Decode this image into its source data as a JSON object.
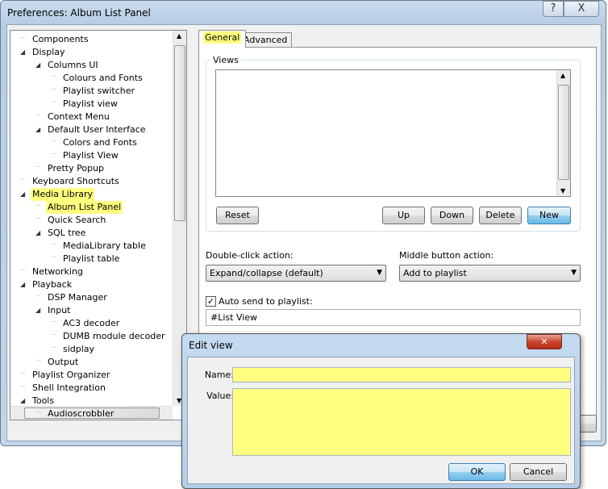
{
  "window": {
    "title": "Preferences: Album List Panel",
    "help_label": "?",
    "close_label": "X"
  },
  "tree": {
    "items": [
      {
        "label": "Components",
        "level": 0,
        "expanded": null
      },
      {
        "label": "Display",
        "level": 0,
        "expanded": true
      },
      {
        "label": "Columns UI",
        "level": 1,
        "expanded": true
      },
      {
        "label": "Colours and Fonts",
        "level": 2,
        "expanded": null
      },
      {
        "label": "Playlist switcher",
        "level": 2,
        "expanded": null
      },
      {
        "label": "Playlist view",
        "level": 2,
        "expanded": null
      },
      {
        "label": "Context Menu",
        "level": 1,
        "expanded": null
      },
      {
        "label": "Default User Interface",
        "level": 1,
        "expanded": true
      },
      {
        "label": "Colors and Fonts",
        "level": 2,
        "expanded": null
      },
      {
        "label": "Playlist View",
        "level": 2,
        "expanded": null
      },
      {
        "label": "Pretty Popup",
        "level": 1,
        "expanded": null
      },
      {
        "label": "Keyboard Shortcuts",
        "level": 0,
        "expanded": null
      },
      {
        "label": "Media Library",
        "level": 0,
        "expanded": true,
        "highlight": true
      },
      {
        "label": "Album List Panel",
        "level": 1,
        "expanded": null,
        "highlight": true,
        "selected": true
      },
      {
        "label": "Quick Search",
        "level": 1,
        "expanded": null
      },
      {
        "label": "SQL tree",
        "level": 1,
        "expanded": true
      },
      {
        "label": "MediaLibrary table",
        "level": 2,
        "expanded": null
      },
      {
        "label": "Playlist table",
        "level": 2,
        "expanded": null
      },
      {
        "label": "Networking",
        "level": 0,
        "expanded": null
      },
      {
        "label": "Playback",
        "level": 0,
        "expanded": true
      },
      {
        "label": "DSP Manager",
        "level": 1,
        "expanded": null
      },
      {
        "label": "Input",
        "level": 1,
        "expanded": true
      },
      {
        "label": "AC3 decoder",
        "level": 2,
        "expanded": null
      },
      {
        "label": "DUMB module decoder",
        "level": 2,
        "expanded": null
      },
      {
        "label": "sidplay",
        "level": 2,
        "expanded": null
      },
      {
        "label": "Output",
        "level": 1,
        "expanded": null
      },
      {
        "label": "Playlist Organizer",
        "level": 0,
        "expanded": null
      },
      {
        "label": "Shell Integration",
        "level": 0,
        "expanded": null
      },
      {
        "label": "Tools",
        "level": 0,
        "expanded": true
      },
      {
        "label": "Audioscrobbler",
        "level": 1,
        "expanded": null
      }
    ]
  },
  "tabs": [
    {
      "label": "General",
      "active": true
    },
    {
      "label": "Advanced",
      "active": false
    }
  ],
  "views": {
    "label": "Views",
    "buttons": {
      "reset": "Reset",
      "up": "Up",
      "down": "Down",
      "delete": "Delete",
      "new": "New"
    }
  },
  "double_click": {
    "label": "Double-click action:",
    "value": "Expand/collapse (default)"
  },
  "middle_button": {
    "label": "Middle button action:",
    "value": "Add to playlist"
  },
  "auto_send": {
    "label": "Auto send to playlist:",
    "checked": true,
    "value": "#List View"
  },
  "edit_view": {
    "title": "Edit view",
    "name_label": "Name:",
    "name_value": "",
    "value_label": "Value:",
    "value_value": "",
    "ok": "OK",
    "cancel": "Cancel"
  },
  "colors": {
    "highlight": "#ffff80",
    "accent": "#3c7fb1"
  }
}
